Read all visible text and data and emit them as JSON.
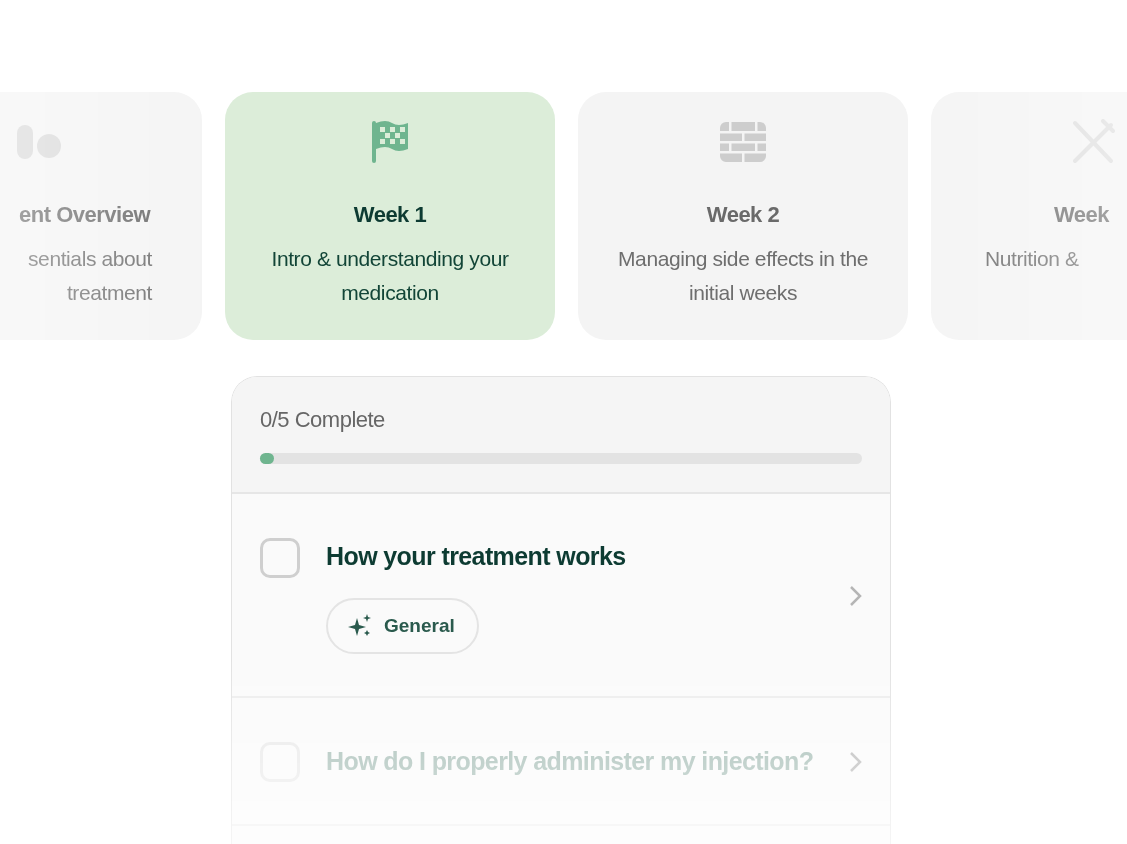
{
  "weeks": [
    {
      "kind": "pills",
      "title": "ent Overview",
      "description": "sentials about treatment",
      "selected": false
    },
    {
      "kind": "flag",
      "title": "Week 1",
      "description": "Intro & understanding your medication",
      "selected": true
    },
    {
      "kind": "bricks",
      "title": "Week 2",
      "description": "Managing side effects in the initial weeks",
      "selected": false
    },
    {
      "kind": "utensils",
      "title": "Week",
      "description": "Nutrition &",
      "selected": false
    }
  ],
  "progress": {
    "label": "0/5 Complete",
    "level": 0.02
  },
  "lessons": [
    {
      "title": "How your treatment works",
      "checked": false,
      "tag": "General"
    },
    {
      "title": "How do I properly administer my injection?",
      "checked": false
    }
  ]
}
